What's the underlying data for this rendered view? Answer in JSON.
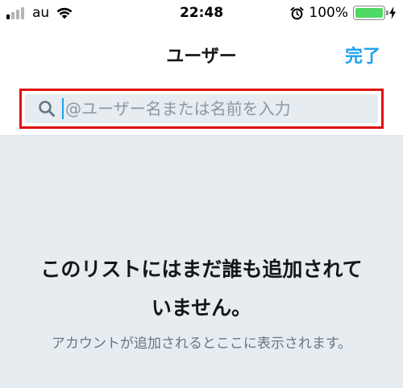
{
  "status_bar": {
    "carrier": "au",
    "time": "22:48",
    "battery_percent": "100%",
    "battery_level": 1.0,
    "signal_bars": 4,
    "signal_bars_active": 1,
    "icons": [
      "wifi-icon",
      "alarm-icon",
      "battery-icon",
      "charging-bolt-icon"
    ]
  },
  "nav": {
    "title": "ユーザー",
    "done_label": "完了"
  },
  "search": {
    "placeholder": "@ユーザー名または名前を入力",
    "value": "",
    "icon": "search-icon"
  },
  "empty_state": {
    "title": "このリストにはまだ誰も追加されていません。",
    "description": "アカウントが追加されるとここに表示されます。"
  },
  "colors": {
    "accent": "#1da1f2",
    "highlight_border": "#e01010",
    "empty_background": "#e6ecf0",
    "battery_fill": "#4cd964"
  }
}
